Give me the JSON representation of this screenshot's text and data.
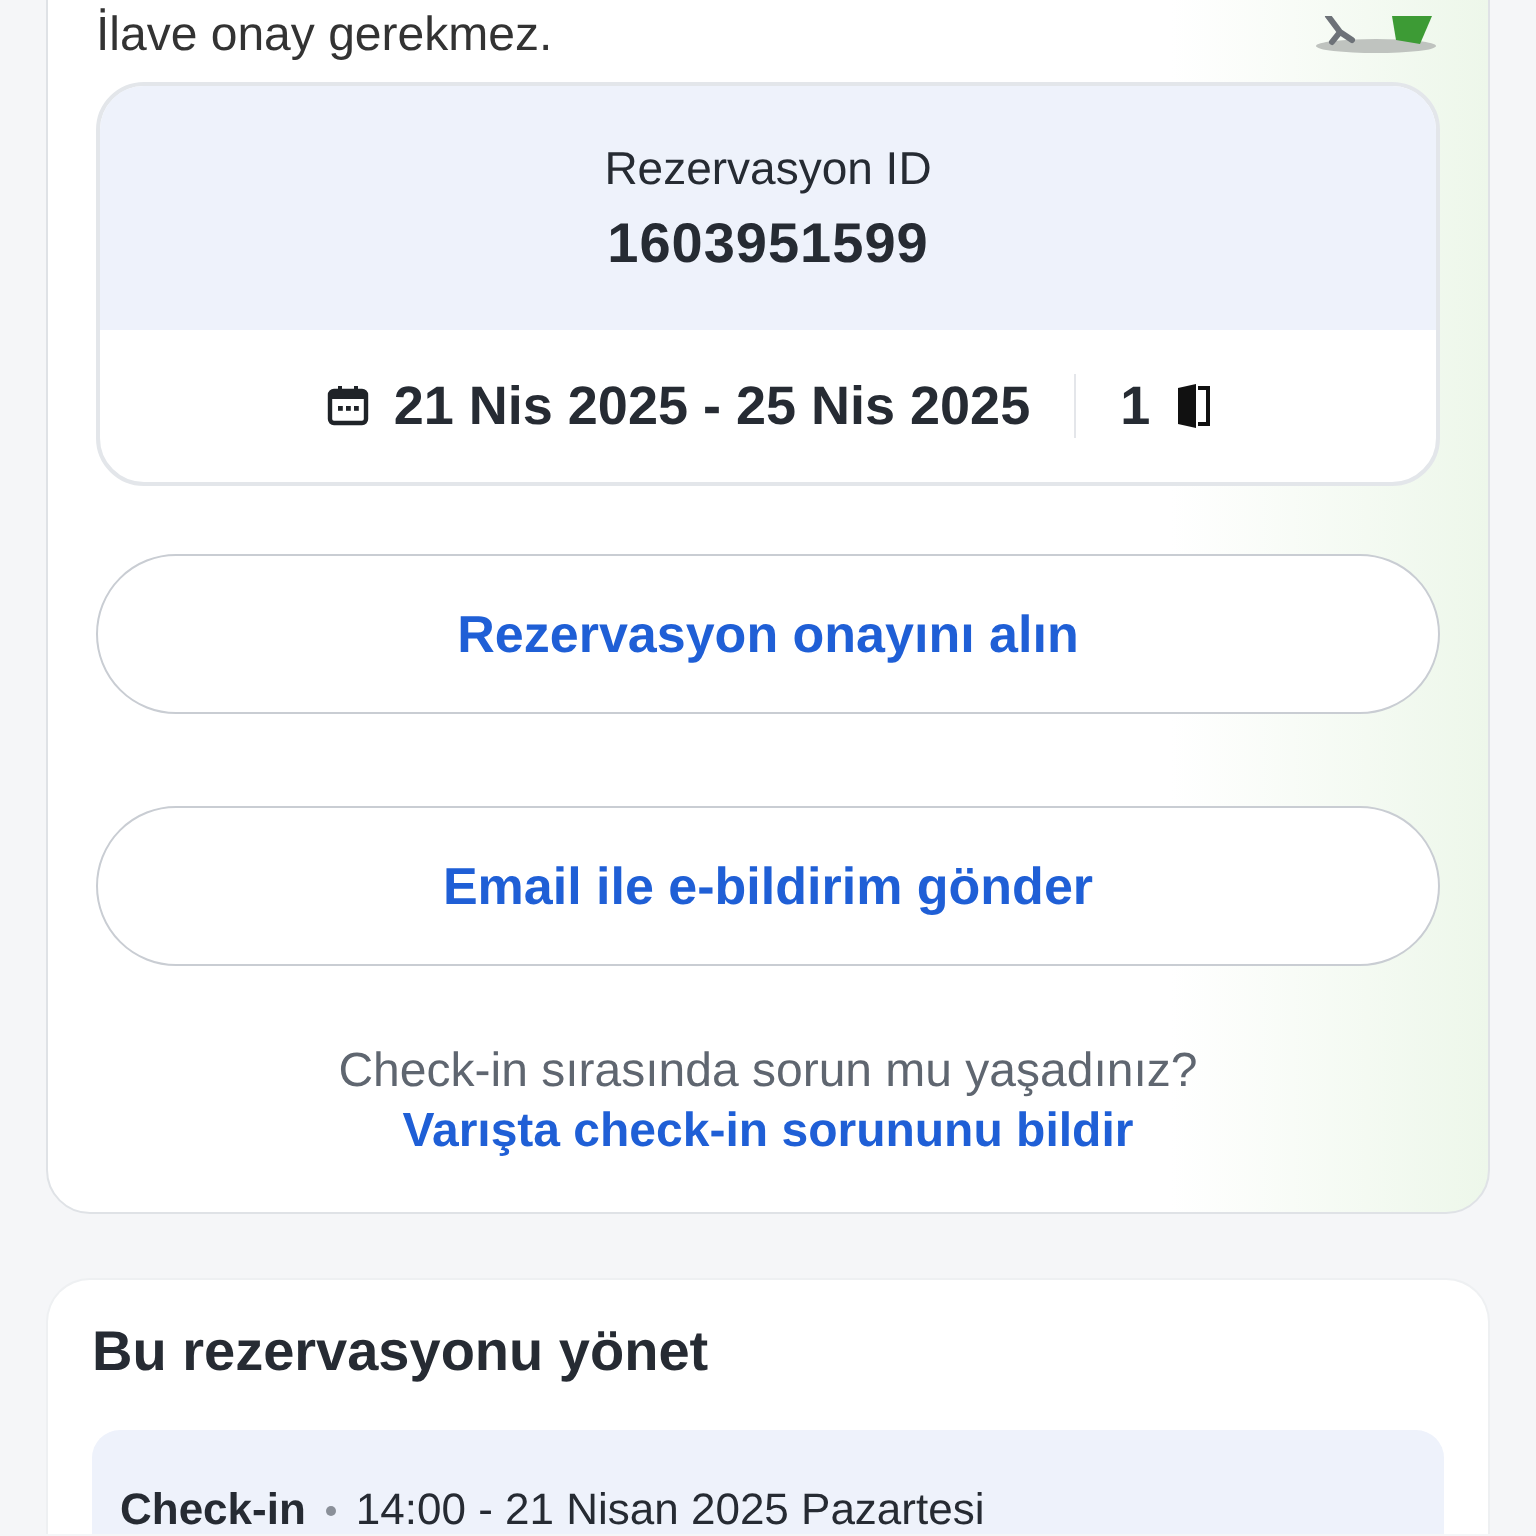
{
  "status_card": {
    "message": "İlave onay gerekmez.",
    "reservation": {
      "id_label": "Rezervasyon ID",
      "id": "1603951599",
      "dates": "21 Nis 2025 - 25 Nis 2025",
      "rooms": "1"
    },
    "buttons": [
      "Rezervasyon onayını alın",
      "Email ile e-bildirim gönder"
    ],
    "help_text": "Check-in sırasında sorun mu yaşadınız?",
    "help_link": "Varışta check-in sorununu bildir"
  },
  "manage_card": {
    "title": "Bu rezervasyonu yönet",
    "check_in": {
      "label": "Check-in",
      "value": "14:00 - 21 Nisan 2025 Pazartesi"
    }
  }
}
